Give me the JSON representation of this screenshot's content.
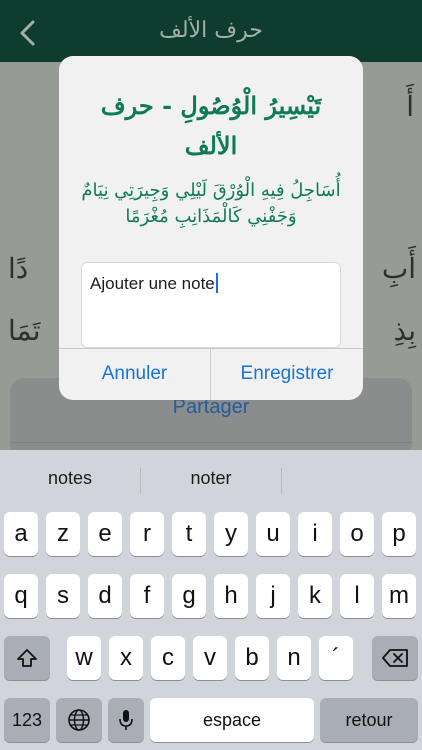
{
  "navbar": {
    "title": "حرف الألف",
    "back_icon": "chevron-left-icon"
  },
  "content": {
    "verse_1": "أَ",
    "verse_2": "أَبِ",
    "verse_3": "دًا",
    "verse_4": "بِذِ",
    "verse_5": "تَمَا"
  },
  "sheet": {
    "share_label": "Partager"
  },
  "alert": {
    "title": "تَيْسِيرُ الْوُصُولِ - حرف الألف",
    "subtitle": "أُسَاجِلُ فِيهِ الْوُرْقَ لَيْلِي وَجِيرَتِي نِيَامٌ وَجَفْنِي كَالْمَذَانِبِ مُغْرَمًا",
    "note_value": "Ajouter une note",
    "cancel_label": "Annuler",
    "save_label": "Enregistrer"
  },
  "keyboard": {
    "suggestions": [
      "notes",
      "noter"
    ],
    "row1": [
      "a",
      "z",
      "e",
      "r",
      "t",
      "y",
      "u",
      "i",
      "o",
      "p"
    ],
    "row2": [
      "q",
      "s",
      "d",
      "f",
      "g",
      "h",
      "j",
      "k",
      "l",
      "m"
    ],
    "row3": [
      "w",
      "x",
      "c",
      "v",
      "b",
      "n",
      "´"
    ],
    "numbers_label": "123",
    "space_label": "espace",
    "return_label": "retour"
  },
  "colors": {
    "navbar": "#124b3a",
    "accent_green": "#0f7a57",
    "ios_blue": "#1a73d4"
  }
}
